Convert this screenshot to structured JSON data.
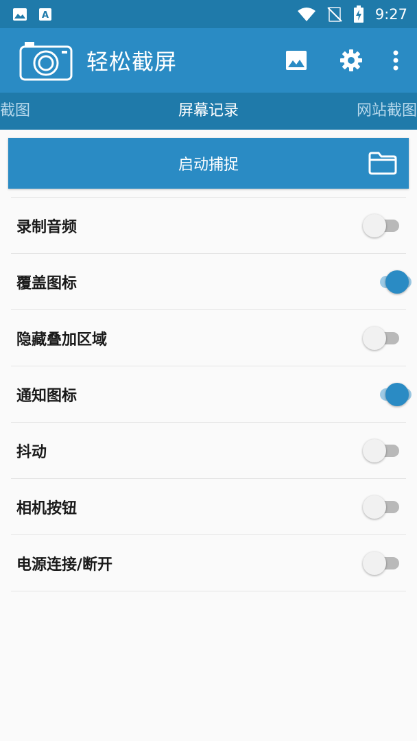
{
  "status_bar": {
    "time": "9:27",
    "icons": [
      "image-icon",
      "a-icon",
      "wifi-icon",
      "signal-off-icon",
      "battery-charging-icon"
    ]
  },
  "app_bar": {
    "title": "轻松截屏",
    "actions": [
      "gallery-icon",
      "settings-icon",
      "more-icon"
    ]
  },
  "tabs": {
    "left": "截图",
    "active": "屏幕记录",
    "right": "网站截图"
  },
  "capture": {
    "label": "启动捕捉"
  },
  "settings": [
    {
      "label": "录制音频",
      "enabled": false
    },
    {
      "label": "覆盖图标",
      "enabled": true
    },
    {
      "label": "隐藏叠加区域",
      "enabled": false
    },
    {
      "label": "通知图标",
      "enabled": true
    },
    {
      "label": "抖动",
      "enabled": false
    },
    {
      "label": "相机按钮",
      "enabled": false
    },
    {
      "label": "电源连接/断开",
      "enabled": false
    }
  ],
  "colors": {
    "app_bar": "#2a8bc4",
    "status_bar": "#1f7aaa",
    "accent": "#2a8bc4"
  }
}
